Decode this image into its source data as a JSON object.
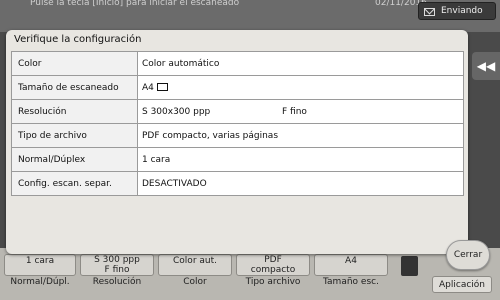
{
  "background": {
    "topbar_text": "Pulse la tecla [Inicio] para iniciar el escaneado",
    "date": "02/11/2016",
    "sending_label": "Enviando",
    "tiles": [
      {
        "value": "1 cara",
        "caption": "Normal/Dúpl."
      },
      {
        "value": "S 300 ppp\nF fino",
        "caption": "Resolución"
      },
      {
        "value": "Color aut.",
        "caption": "Color"
      },
      {
        "value": "PDF\ncompacto",
        "caption": "Tipo archivo"
      },
      {
        "value": "A4",
        "caption": "Tamaño esc."
      }
    ],
    "apply_label": "Aplicación"
  },
  "dialog": {
    "title": "Verifique la configuración",
    "rows": [
      {
        "label": "Color",
        "value": "Color automático"
      },
      {
        "label": "Tamaño de escaneado",
        "value": "A4"
      },
      {
        "label": "Resolución",
        "value": "S 300x300 ppp",
        "extra": "F fino"
      },
      {
        "label": "Tipo de archivo",
        "value": "PDF compacto, varias páginas"
      },
      {
        "label": "Normal/Dúplex",
        "value": "1 cara"
      },
      {
        "label": "Config. escan. separ.",
        "value": "DESACTIVADO"
      }
    ],
    "close_label": "Cerrar",
    "rewind_glyph": "◀◀"
  },
  "colors": {
    "dialog_bg": "#e8e6e1",
    "table_border": "#9a9a9a"
  }
}
